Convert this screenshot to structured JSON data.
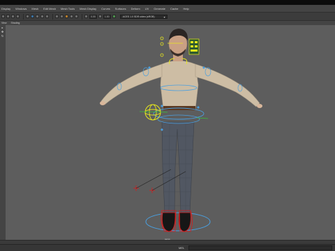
{
  "menubar": {
    "items": [
      "Display",
      "Windows",
      "Mesh",
      "Edit Mesh",
      "Mesh Tools",
      "Mesh Display",
      "Curves",
      "Surfaces",
      "Deform",
      "UV",
      "Generate",
      "Cache",
      "Help"
    ]
  },
  "statusline": {
    "field_a": "0.00",
    "field_b": "1.00",
    "camera_select": "ACES 1.0 SDR-video (sRGB)"
  },
  "panelmenu": {
    "items": [
      "View",
      "Shading"
    ]
  },
  "viewport": {
    "camera_label": "persp"
  },
  "cmdline": {
    "mel_label": "MEL"
  },
  "colors": {
    "viewport_bg": "#5d5d5d",
    "control_yellow": "#e8e81c",
    "control_blue": "#4a9fe0",
    "control_red": "#e01818",
    "control_green": "#39c239"
  }
}
